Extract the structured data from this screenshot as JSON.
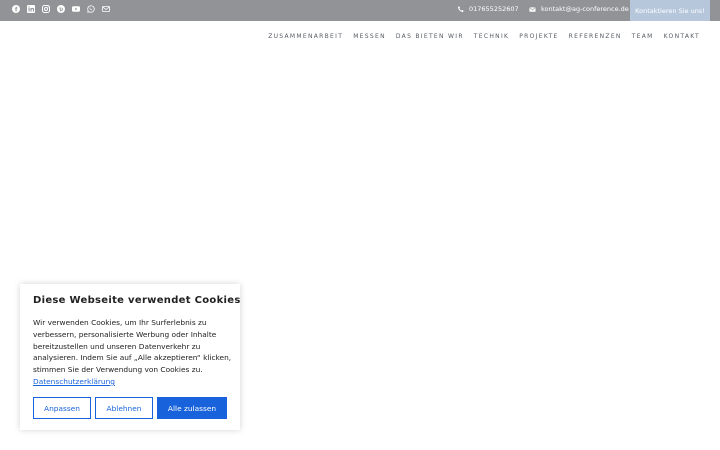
{
  "topbar": {
    "social_icons": [
      "facebook-icon",
      "linkedin-icon",
      "instagram-icon",
      "pinterest-icon",
      "youtube-icon",
      "whatsapp-icon",
      "mail-icon"
    ],
    "phone": "017655252607",
    "email": "kontakt@ag-conference.de",
    "cta_label": "Kontaktieren Sie uns!",
    "colors": {
      "bar": "#919396",
      "cta": "#b6c7dc"
    }
  },
  "nav": {
    "items": [
      {
        "label": "ZUSAMMENARBEIT"
      },
      {
        "label": "MESSEN"
      },
      {
        "label": "DAS BIETEN WIR"
      },
      {
        "label": "TECHNIK"
      },
      {
        "label": "PROJEKTE"
      },
      {
        "label": "REFERENZEN"
      },
      {
        "label": "TEAM"
      },
      {
        "label": "KONTAKT"
      }
    ]
  },
  "cookie_banner": {
    "title": "Diese Webseite verwendet Cookies",
    "text": "Wir verwenden Cookies, um Ihr Surferlebnis zu verbessern, personalisierte Werbung oder Inhalte bereitzustellen und unseren Datenverkehr zu analysieren. Indem Sie auf „Alle akzeptieren“ klicken, stimmen Sie der Verwendung von Cookies zu.",
    "privacy_link": "Datenschutzerklärung",
    "buttons": {
      "customize": "Anpassen",
      "reject": "Ablehnen",
      "accept_all": "Alle zulassen"
    },
    "accent_color": "#1863dc"
  }
}
